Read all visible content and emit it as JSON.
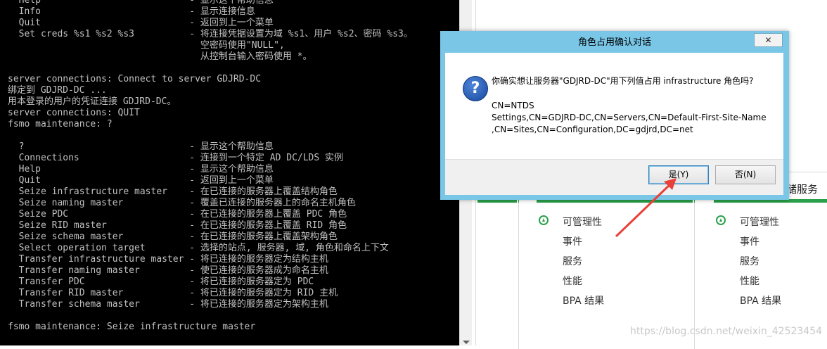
{
  "console": {
    "lines": [
      "  Help                           - 显示这个帮助信息",
      "  Info                           - 显示连接信息",
      "  Quit                           - 返回到上一个菜单",
      "  Set creds %s1 %s2 %s3          - 将连接凭据设置为域 %s1、用户 %s2、密码 %s3。",
      "                                   空密码使用\"NULL\",",
      "                                   从控制台输入密码使用 *。",
      "",
      "server connections: Connect to server GDJRD-DC",
      "绑定到 GDJRD-DC ...",
      "用本登录的用户的凭证连接 GDJRD-DC。",
      "server connections: QUIT",
      "fsmo maintenance: ?",
      "",
      "  ?                              - 显示这个帮助信息",
      "  Connections                    - 连接到一个特定 AD DC/LDS 实例",
      "  Help                           - 显示这个帮助信息",
      "  Quit                           - 返回到上一个菜单",
      "  Seize infrastructure master    - 在已连接的服务器上覆盖结构角色",
      "  Seize naming master            - 覆盖已连接的服务器上的命名主机角色",
      "  Seize PDC                      - 在已连接的服务器上覆盖 PDC 角色",
      "  Seize RID master               - 在已连接的服务器上覆盖 RID 角色",
      "  Seize schema master            - 在已连接的服务器上覆盖架构角色",
      "  Select operation target        - 选择的站点, 服务器, 域, 角色和命名上下文",
      "  Transfer infrastructure master - 将已连接的服务器定为结构主机",
      "  Transfer naming master         - 使已连接的服务器成为命名主机",
      "  Transfer PDC                   - 将已连接的服务器定为 PDC",
      "  Transfer RID master            - 将已连接的服务器定为 RID 主机",
      "  Transfer schema master         - 将已连接的服务器定为架构主机",
      "",
      "fsmo maintenance: Seize infrastructure master"
    ]
  },
  "dialog": {
    "title": "角色占用确认对话",
    "close_label": "✕",
    "message": "你确实想让服务器\"GDJRD-DC\"用下列值占用 infrastructure 角色吗?",
    "dn_lines": [
      "CN=NTDS",
      "Settings,CN=GDJRD-DC,CN=Servers,CN=Default-First-Site-Name",
      ",CN=Sites,CN=Configuration,DC=gdjrd,DC=net"
    ],
    "yes_label": "是(Y)",
    "no_label": "否(N)",
    "icon": "question-icon"
  },
  "server_manager": {
    "tile_title_fragment": "储服务",
    "tiles": [
      {
        "items": [
          "可管理性",
          "事件",
          "服务",
          "性能",
          "BPA 结果"
        ]
      },
      {
        "items": [
          "可管理性",
          "事件",
          "服务",
          "性能",
          "BPA 结果"
        ]
      }
    ],
    "status_color": "#2aa04a"
  },
  "annotation": {
    "arrow_color": "#e8413a"
  },
  "watermark": "https://blog.csdn.net/weixin_42523454"
}
